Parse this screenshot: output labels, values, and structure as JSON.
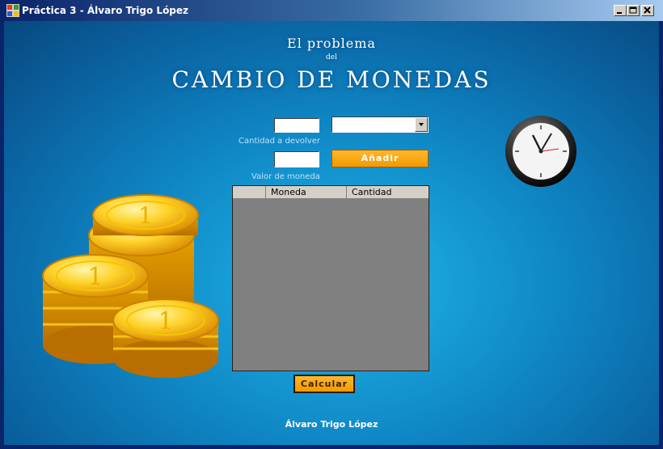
{
  "window": {
    "title": "Práctica 3 - Álvaro Trigo López",
    "controls": [
      "minimize",
      "maximize",
      "close"
    ]
  },
  "header": {
    "line1": "El problema",
    "line2": "del",
    "line3": "CAMBIO DE MONEDAS"
  },
  "form": {
    "amount_value": "",
    "amount_label": "Cantidad a devolver",
    "coin_select_value": "",
    "coin_value": "",
    "coin_label": "Valor de moneda",
    "add_button": "Añadir",
    "calc_button": "Calcular"
  },
  "grid": {
    "columns": [
      "",
      "Moneda",
      "Cantidad"
    ],
    "rows": []
  },
  "footer": {
    "author": "Álvaro Trigo López"
  },
  "icons": {
    "app": "app-icon",
    "clock": "clock-icon",
    "coins": "coin-stack-image"
  },
  "colors": {
    "background": "#0f86c4",
    "button": "#f29a00",
    "grid": "#808080"
  }
}
